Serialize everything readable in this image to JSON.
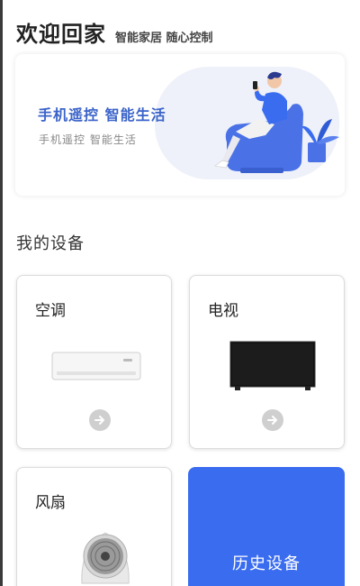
{
  "header": {
    "title": "欢迎回家",
    "subtitle": "智能家居 随心控制"
  },
  "banner": {
    "title": "手机遥控  智能生活",
    "subtitle": "手机遥控  智能生活",
    "illustration_icon": "person-on-armchair-with-phone-illustration",
    "accent_color": "#3a63c9"
  },
  "devices_section": {
    "title": "我的设备",
    "devices": [
      {
        "name": "空调",
        "image_icon": "air-conditioner-image",
        "action_icon": "arrow-right-circle-icon"
      },
      {
        "name": "电视",
        "image_icon": "television-image",
        "action_icon": "arrow-right-circle-icon"
      },
      {
        "name": "风扇",
        "image_icon": "fan-image"
      }
    ],
    "history": {
      "label": "历史设备",
      "color": "#3a6cf0"
    }
  }
}
